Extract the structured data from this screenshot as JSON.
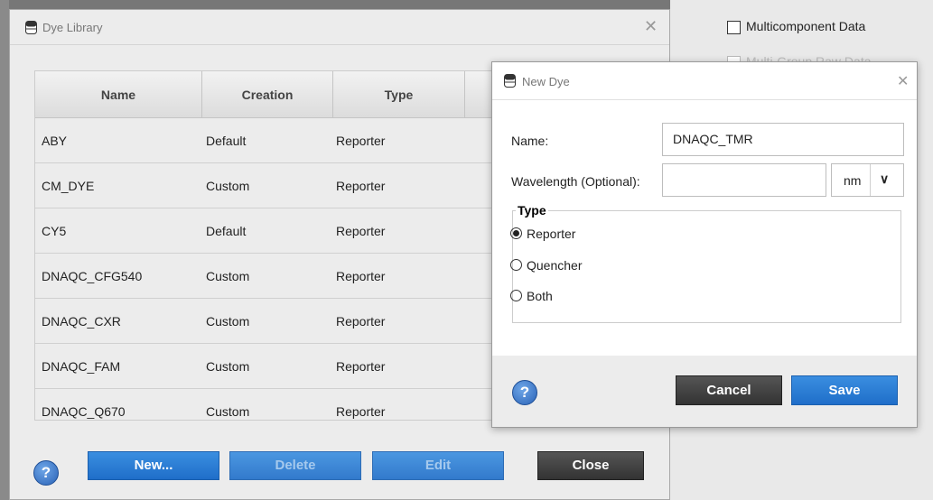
{
  "right_panel": {
    "multicomponent_label": "Multicomponent Data",
    "partial_label": "Multi-Group Raw Data"
  },
  "dye_library": {
    "title": "Dye Library",
    "columns": [
      "Name",
      "Creation",
      "Type"
    ],
    "rows": [
      {
        "name": "ABY",
        "creation": "Default",
        "type": "Reporter"
      },
      {
        "name": "CM_DYE",
        "creation": "Custom",
        "type": "Reporter"
      },
      {
        "name": "CY5",
        "creation": "Default",
        "type": "Reporter"
      },
      {
        "name": "DNAQC_CFG540",
        "creation": "Custom",
        "type": "Reporter"
      },
      {
        "name": "DNAQC_CXR",
        "creation": "Custom",
        "type": "Reporter"
      },
      {
        "name": "DNAQC_FAM",
        "creation": "Custom",
        "type": "Reporter"
      },
      {
        "name": "DNAQC_Q670",
        "creation": "Custom",
        "type": "Reporter"
      }
    ],
    "buttons": {
      "new": "New...",
      "delete": "Delete",
      "edit": "Edit",
      "close": "Close"
    }
  },
  "new_dye": {
    "title": "New Dye",
    "name_label": "Name:",
    "name_value": "DNAQC_TMR",
    "wavelength_label": "Wavelength (Optional):",
    "wavelength_value": "",
    "unit": "nm",
    "type_legend": "Type",
    "types": [
      {
        "label": "Reporter",
        "selected": true
      },
      {
        "label": "Quencher",
        "selected": false
      },
      {
        "label": "Both",
        "selected": false
      }
    ],
    "cancel": "Cancel",
    "save": "Save"
  },
  "colors": {
    "accent_blue": "#2a7bd6",
    "dark_button": "#3c3c3c"
  }
}
